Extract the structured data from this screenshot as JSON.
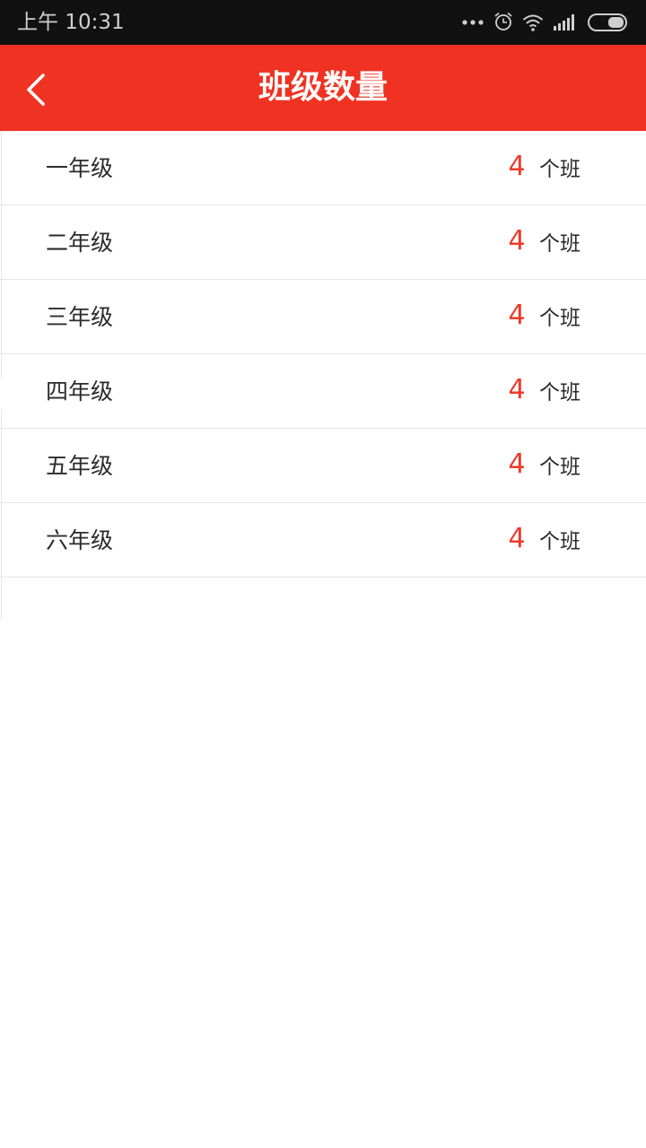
{
  "status_bar": {
    "time": "上午 10:31",
    "icons": [
      "more-dots-icon",
      "alarm-icon",
      "wifi-icon",
      "signal-icon",
      "battery-icon"
    ]
  },
  "nav": {
    "title": "班级数量",
    "back_icon": "chevron-left-icon"
  },
  "colors": {
    "header": "#f03222",
    "count_accent": "#ee3a2a",
    "status_bar": "#111111"
  },
  "grades": [
    {
      "label": "一年级",
      "count": "4",
      "unit": "个班"
    },
    {
      "label": "二年级",
      "count": "4",
      "unit": "个班"
    },
    {
      "label": "三年级",
      "count": "4",
      "unit": "个班"
    },
    {
      "label": "四年级",
      "count": "4",
      "unit": "个班"
    },
    {
      "label": "五年级",
      "count": "4",
      "unit": "个班"
    },
    {
      "label": "六年级",
      "count": "4",
      "unit": "个班"
    }
  ]
}
